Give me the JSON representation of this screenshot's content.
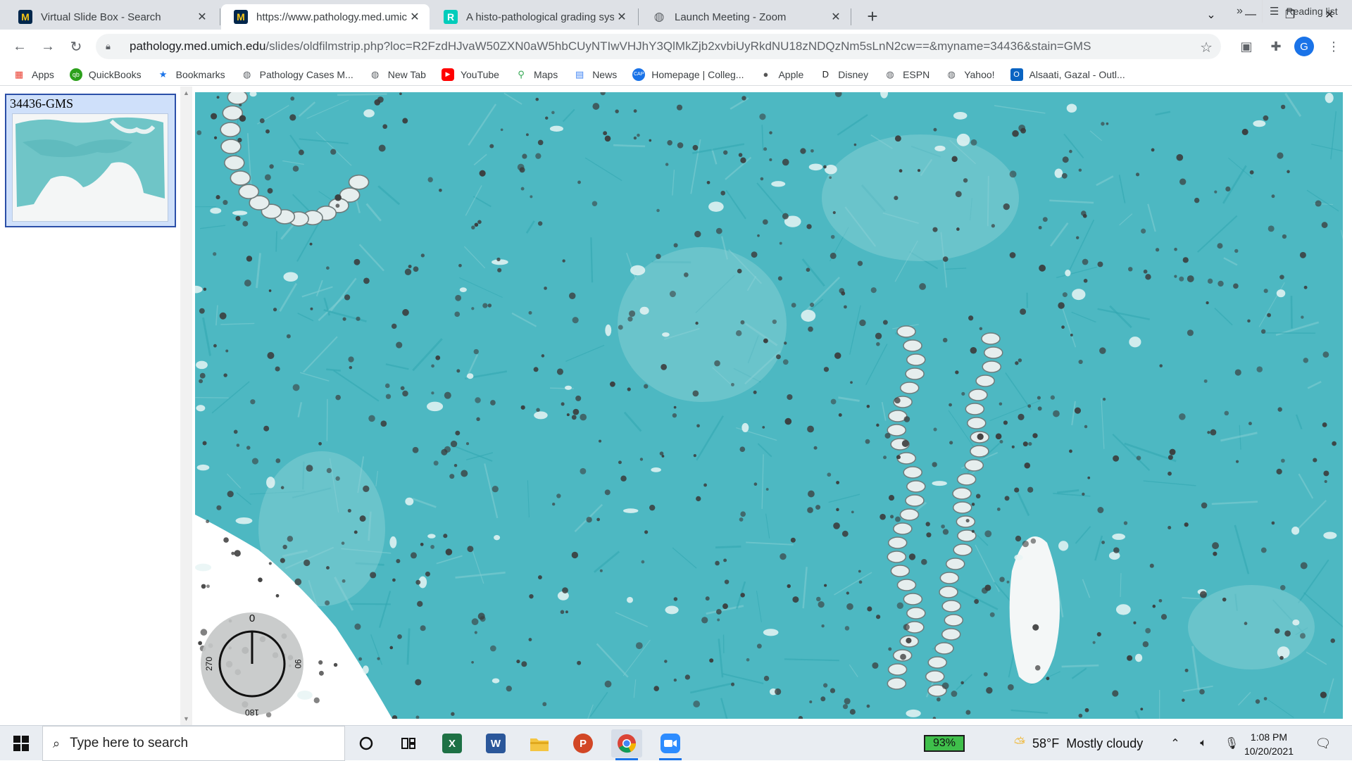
{
  "browser": {
    "tabs": [
      {
        "title": "Virtual Slide Box - Search",
        "favicon": "umich-m-icon"
      },
      {
        "title": "https://www.pathology.med.umich.edu/slides/oldfilmstrip.php",
        "favicon": "umich-m-icon"
      },
      {
        "title": "A histo-pathological grading system",
        "favicon": "researchgate-r-icon"
      },
      {
        "title": "Launch Meeting - Zoom",
        "favicon": "globe-icon"
      }
    ],
    "active_tab_index": 1,
    "new_tab_label": "+",
    "url_host": "pathology.med.umich.edu",
    "url_path": "/slides/oldfilmstrip.php?loc=R2FzdHJvaW50ZXN0aW5hbCUyNTIwVHJhY3QlMkZjb2xvbiUyRkdNU18zNDQzNm5sLnN2cw==&myname=34436&stain=GMS",
    "profile_initial": "G",
    "bookmarks": [
      {
        "label": "Apps",
        "icon": "apps-grid-icon",
        "color": "#ea4335"
      },
      {
        "label": "QuickBooks",
        "icon": "quickbooks-icon",
        "color": "#2ca01c"
      },
      {
        "label": "Bookmarks",
        "icon": "star-icon",
        "color": "#1a73e8"
      },
      {
        "label": "Pathology Cases M...",
        "icon": "globe-icon",
        "color": "#5f6368"
      },
      {
        "label": "New Tab",
        "icon": "globe-icon",
        "color": "#5f6368"
      },
      {
        "label": "YouTube",
        "icon": "youtube-icon",
        "color": "#ff0000"
      },
      {
        "label": "Maps",
        "icon": "maps-pin-icon",
        "color": "#34a853"
      },
      {
        "label": "News",
        "icon": "news-icon",
        "color": "#4285f4"
      },
      {
        "label": "Homepage | Colleg...",
        "icon": "cap-icon",
        "color": "#1a73e8"
      },
      {
        "label": "Apple",
        "icon": "apple-icon",
        "color": "#555555"
      },
      {
        "label": "Disney",
        "icon": "disney-icon",
        "color": "#222222"
      },
      {
        "label": "ESPN",
        "icon": "globe-icon",
        "color": "#5f6368"
      },
      {
        "label": "Yahoo!",
        "icon": "globe-icon",
        "color": "#5f6368"
      },
      {
        "label": "Alsaati, Gazal - Outl...",
        "icon": "outlook-icon",
        "color": "#0a64c2"
      }
    ],
    "more_bookmarks": "»",
    "reading_list": "Reading list"
  },
  "filmstrip": {
    "slide_label": "34436-GMS"
  },
  "viewer": {
    "rotation_dial": {
      "top": "0",
      "right": "90",
      "bottom": "180",
      "left": "270",
      "angle_deg": 0
    },
    "stain_colors": {
      "background": "#4db8c2",
      "light": "#cfe6e4",
      "dark": "#3a3a3a"
    }
  },
  "taskbar": {
    "search_placeholder": "Type here to search",
    "apps": [
      {
        "name": "cortana-icon"
      },
      {
        "name": "task-view-icon"
      },
      {
        "name": "excel-icon",
        "glyph": "X",
        "color": "#1e7145"
      },
      {
        "name": "word-icon",
        "glyph": "W",
        "color": "#2b579a"
      },
      {
        "name": "file-explorer-icon",
        "glyph": "",
        "color": "#f4c542"
      },
      {
        "name": "powerpoint-icon",
        "glyph": "P",
        "color": "#d24726"
      },
      {
        "name": "chrome-icon",
        "glyph": "",
        "color": "#4285f4"
      },
      {
        "name": "zoom-icon",
        "glyph": "",
        "color": "#2d8cff"
      }
    ],
    "battery": "93%",
    "weather_temp": "58°F",
    "weather_desc": "Mostly cloudy",
    "time": "1:08 PM",
    "date": "10/20/2021"
  }
}
